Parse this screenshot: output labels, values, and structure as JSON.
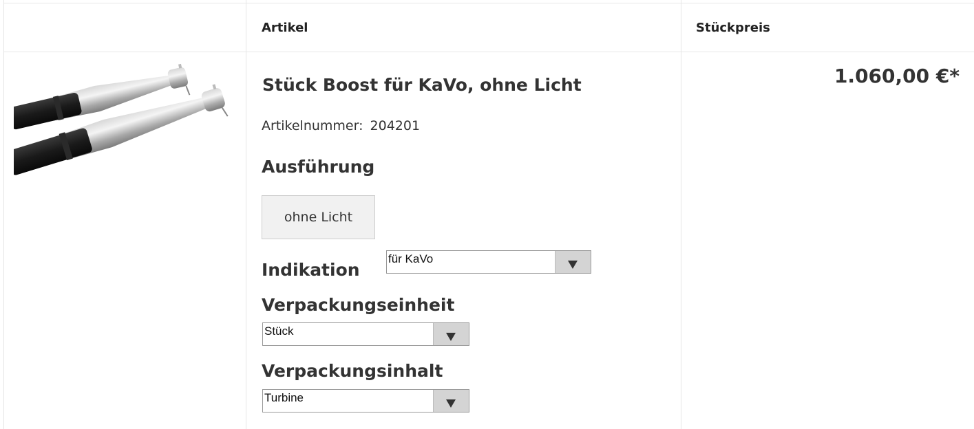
{
  "table": {
    "headers": {
      "image": "",
      "article": "Artikel",
      "unit_price": "Stückpreis"
    }
  },
  "product": {
    "image_icon": "dental-turbine-handpiece-image",
    "title": "Stück Boost für KaVo, ohne Licht",
    "article_number_label": "Artikelnummer:",
    "article_number": "204201",
    "price": "1.060,00 €*",
    "options": {
      "ausfuehrung": {
        "label": "Ausführung",
        "selected": "ohne Licht"
      },
      "indikation": {
        "label": "Indikation",
        "selected": "für KaVo"
      },
      "verpackungseinheit": {
        "label": "Verpackungseinheit",
        "selected": "Stück"
      },
      "verpackungsinhalt": {
        "label": "Verpackungsinhalt",
        "selected": "Turbine"
      }
    }
  }
}
